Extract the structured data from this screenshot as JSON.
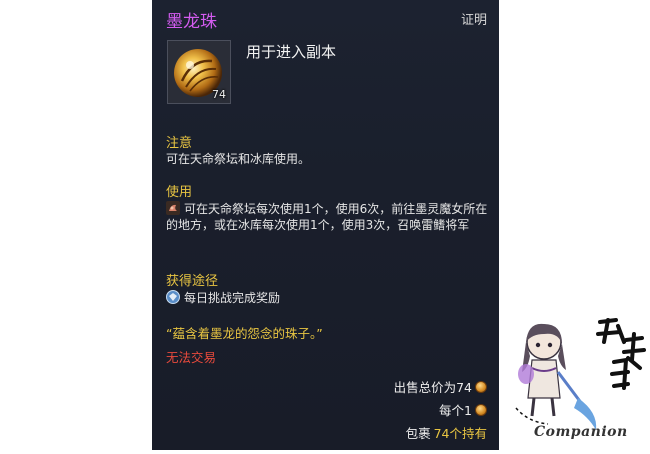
{
  "item": {
    "name": "墨龙珠",
    "category": "证明",
    "count": "74",
    "description": "用于进入副本"
  },
  "sections": {
    "notice_title": "注意",
    "notice_text": "可在天命祭坛和冰库使用。",
    "use_title": "使用",
    "use_text": "可在天命祭坛每次使用1个，使用6次，前往墨灵魔女所在的地方，或在冰库每次使用1个，使用3次，召唤雷鳍将军",
    "obtain_title": "获得途径",
    "obtain_text": "每日挑战完成奖励"
  },
  "flavor_text": "“蕴含着墨龙的怨念的珠子。”",
  "trade_status": "无法交易",
  "price": {
    "total_label": "出售总价为74",
    "each_label": "每个1",
    "inventory_prefix": "包裹",
    "inventory_count": "74个持有"
  },
  "watermark": {
    "text": "Companion",
    "calligraphy": "攻略组"
  },
  "colors": {
    "name": "#d45cf0",
    "section_title": "#e8c542",
    "trade_restricted": "#e84a3c",
    "tooltip_bg": "#1a1f2c"
  },
  "icons": {
    "item": "dragon-orb-icon",
    "use": "ingredient-icon",
    "obtain": "daily-challenge-icon",
    "coin": "coin-icon"
  }
}
